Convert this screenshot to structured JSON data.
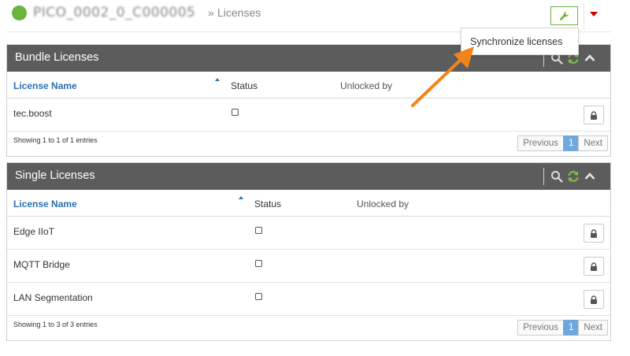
{
  "header": {
    "device_name": "PICO_0002_0_C000005",
    "separator": "»",
    "breadcrumb_current": "Licenses"
  },
  "dropdown": {
    "items": [
      {
        "label": "Synchronize licenses"
      }
    ]
  },
  "colors": {
    "status_online": "#6cb33e",
    "panel_header": "#5c5c5c",
    "link_blue": "#2a6fb0",
    "active_page": "#6fa8dc",
    "annotation_arrow": "#f08519",
    "alert_caret": "#cc0000"
  },
  "icons": {
    "wrench": "wrench-icon",
    "search": "search-icon",
    "refresh": "refresh-icon",
    "collapse": "chevron-up-icon",
    "lock": "lock-icon"
  },
  "bundle": {
    "title": "Bundle Licenses",
    "columns": {
      "name": "License Name",
      "status": "Status",
      "unlocked_by": "Unlocked by"
    },
    "rows": [
      {
        "name": "tec.boost"
      }
    ],
    "info": "Showing 1 to 1 of 1 entries",
    "pager": {
      "previous": "Previous",
      "page": "1",
      "next": "Next"
    }
  },
  "single": {
    "title": "Single Licenses",
    "columns": {
      "name": "License Name",
      "status": "Status",
      "unlocked_by": "Unlocked by"
    },
    "rows": [
      {
        "name": "Edge IIoT"
      },
      {
        "name": "MQTT Bridge"
      },
      {
        "name": "LAN Segmentation"
      }
    ],
    "info": "Showing 1 to 3 of 3 entries",
    "pager": {
      "previous": "Previous",
      "page": "1",
      "next": "Next"
    }
  }
}
